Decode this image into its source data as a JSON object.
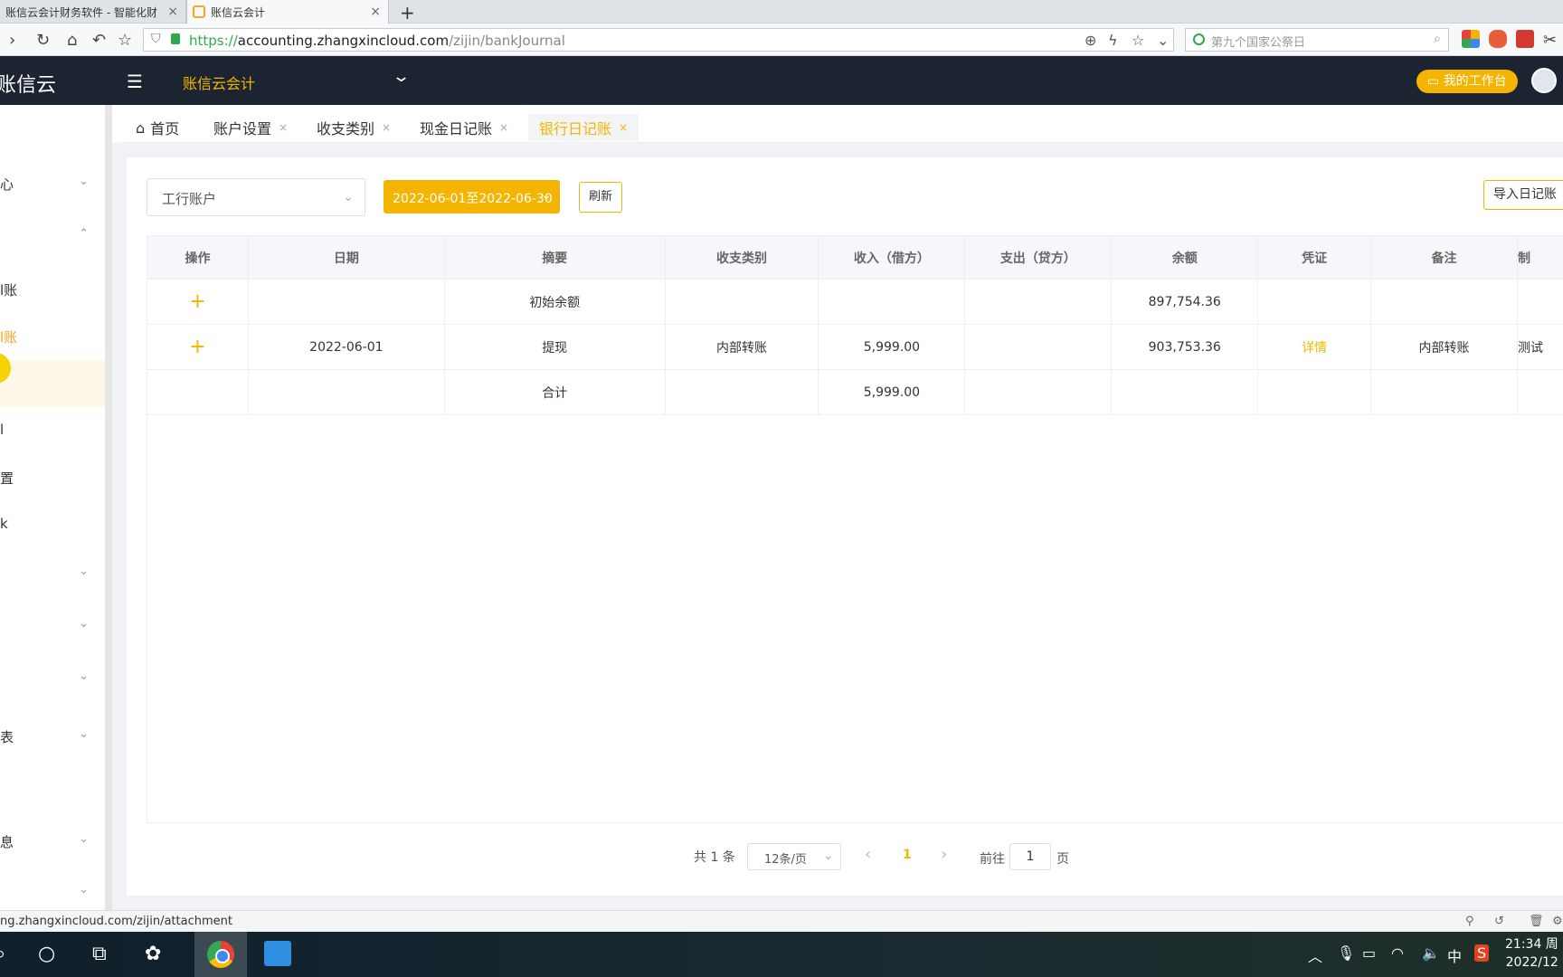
{
  "browser": {
    "tabs": [
      {
        "title": "账信云会计财务软件 - 智能化财",
        "active": false
      },
      {
        "title": "账信云会计",
        "active": true
      }
    ],
    "url": {
      "scheme": "https://",
      "host": "accounting.zhangxincloud.com",
      "path": "/zijin/bankJournal"
    },
    "search_placeholder": "第九个国家公祭日",
    "status_url": "ng.zhangxincloud.com/zijin/attachment"
  },
  "header": {
    "logo": "账信云",
    "company": "账信云会计",
    "workbench": "我的工作台"
  },
  "sidebar": {
    "items": [
      {
        "label": "心",
        "chevron": "down"
      },
      {
        "label": "",
        "chevron": "up"
      },
      {
        "label": "l账",
        "chevron": ""
      },
      {
        "label": "l账",
        "chevron": "",
        "highlight": true
      },
      {
        "label": "l",
        "chevron": ""
      },
      {
        "label": "置",
        "chevron": ""
      },
      {
        "label": "k",
        "chevron": ""
      },
      {
        "label": "",
        "chevron": "down"
      },
      {
        "label": "",
        "chevron": "down"
      },
      {
        "label": "",
        "chevron": "down"
      },
      {
        "label": "表",
        "chevron": "down"
      },
      {
        "label": "息",
        "chevron": "down"
      },
      {
        "label": "",
        "chevron": "down"
      }
    ]
  },
  "page_tabs": [
    {
      "label": "首页",
      "closable": false,
      "active": false
    },
    {
      "label": "账户设置",
      "closable": true,
      "active": false
    },
    {
      "label": "收支类别",
      "closable": true,
      "active": false
    },
    {
      "label": "现金日记账",
      "closable": true,
      "active": false
    },
    {
      "label": "银行日记账",
      "closable": true,
      "active": true
    }
  ],
  "toolbar": {
    "account": "工行账户",
    "date_range": "2022-06-01至2022-06-30",
    "refresh": "刷新",
    "import": "导入日记账"
  },
  "table": {
    "columns": [
      "操作",
      "日期",
      "摘要",
      "收支类别",
      "收入（借方）",
      "支出（贷方）",
      "余额",
      "凭证",
      "备注",
      "制"
    ],
    "rows": [
      {
        "action": "+",
        "date": "",
        "summary": "初始余额",
        "category": "",
        "income": "",
        "expense": "",
        "balance": "897,754.36",
        "voucher": "",
        "remark": "",
        "maker": ""
      },
      {
        "action": "+",
        "date": "2022-06-01",
        "summary": "提现",
        "category": "内部转账",
        "income": "5,999.00",
        "expense": "",
        "balance": "903,753.36",
        "voucher": "详情",
        "remark": "内部转账",
        "maker": "测试"
      },
      {
        "action": "",
        "date": "",
        "summary": "合计",
        "category": "",
        "income": "5,999.00",
        "expense": "",
        "balance": "",
        "voucher": "",
        "remark": "",
        "maker": ""
      }
    ]
  },
  "pagination": {
    "total": "共 1 条",
    "page_size": "12条/页",
    "current": "1",
    "goto_label": "前往",
    "goto_value": "1",
    "page_label": "页"
  },
  "taskbar": {
    "ime": "中",
    "time": "21:34 周",
    "date": "2022/12"
  },
  "colors": {
    "accent": "#f5b400",
    "header_bg": "#1b2430"
  }
}
